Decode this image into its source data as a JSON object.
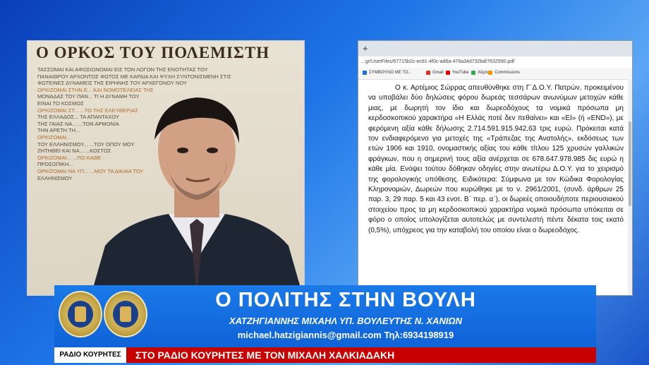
{
  "poster": {
    "title": "Ο ΟΡΚΟΣ ΤΟΥ ΠΟΛΕΜΙΣΤΗ",
    "lines": [
      "ΤΑΣΣΟΜΑΙ ΚΑΙ ΑΦΟΣΙΩΝΟΜΑΙ ΕΙΣ ΤΟΝ ΛΟΓΟΝ ΤΗΣ ΕΝΟΤΗΤΑΣ ΤΟΥ",
      "ΠΑΝΑΙΘΡΟΥ ΑΡΧΟΝΤΟΣ ΦΩΤΟΣ ΜΕ ΚΑΡΔΙΑ ΚΑΙ ΨΥΧΗ ΣΥΝΤΟΝΙΣΜΕΝΗ ΣΤΙΣ",
      "ΦΩΤΕΙΝΕΣ ΔΥΝΑΜΕΙΣ ΤΗΣ ΕΙΡΗΝΗΣ ΤΟΥ ΑΡΧΕΓΟΝΟΥ ΝΟΥ",
      "ΟΡΚΙΖΟΜΑΙ ΣΤΗΝ Ε... ΚΑΙ ΝΟΜΟΤΕΛΕΙΑΣ ΤΗΣ",
      "ΜΟΝΑΔΑΣ ΤΟΥ ΠΑΝ... ΤΙ Η ΔΥΝΑΜΗ ΤΟΥ",
      "ΕΙΝΑΙ ΤΟ ΚΟΣΜΟΣ",
      "ΟΡΚΙΖΟΜΑΙ ΣΤ... ...ΤΟ ΤΗΣ ΕΛΕΥΘΕΡΙΑΣ",
      "ΤΗΣ ΕΛΛΑΔΟΣ... ΤΑ ΑΠΑΝΤΑΧΟΥ",
      "ΤΗΣ ΓΑΙΑΣ ΝΑ... ...ΤΟΝ ΑΡΜΟΝΙΑ",
      "ΤΗΝ ΑΡΕΤΗ ΤΗ...",
      "ΟΡΚΙΖΟΜΑΙ...",
      "ΤΟΥ ΕΛΛΗΝΙΣΜΟΥ... ...ΤΟΥ ΟΠΟΥ ΜΟΥ",
      "ΖΗΤΗΘΕΙ ΚΑΙ ΝΑ... ...ΚΟΣΤΟΣ",
      "ΟΡΚΙΖΟΜΑΙ... ...ΠΟ ΚΑΘΕ",
      "ΠΡΟΣΩΠΙΚΗ...",
      "ΟΡΚΙΖΟΜΑΙ ΝΑ ΥΠ... ...ΜΟΥ ΤΑ ΔΙΚΑΙΑ ΤΟΥ",
      "ΕΛΛΗΝΙΣΜΟΥ"
    ]
  },
  "browser": {
    "new_tab_icon": "+",
    "url": "...gr/UserFiles/67715b2c-ec81-4f0c-ad6a-476a34d732bd/7632590.pdf",
    "bookmarks": [
      {
        "label": "ΣΥΜΒΟΥΛΙΟ ΜΕ ΤΟ...",
        "color": "#1f6fd1"
      },
      {
        "label": "Gmail",
        "color": "#d93025"
      },
      {
        "label": "YouTube",
        "color": "#e00000"
      },
      {
        "label": "Χάρτες",
        "color": "#34a853"
      },
      {
        "label": "Commissions",
        "color": "#f29900"
      }
    ],
    "document_text": "Ο κ. Αρτέμιος Σώρρας απευθύνθηκε στη Γ΄Δ.Ο.Υ. Πατρών, προκειμένου να υποβάλει δύο δηλώσεις φόρου δωρεάς τεσσάρων ανωνύμων μετοχών κάθε μιας, με δωρητή τον ίδιο και δωρεοδόχους τα νομικά πρόσωπα μη κερδοσκοπικού χαρακτήρα «Η Ελλάς ποτέ δεν πεθαίνει» και «ΕΙ» (ή «END»), με φερόμενη αξία κάθε δήλωσης 2.714.591.915.942,63 τρις ευρώ. Πρόκειται κατά τον ενδιαφερόμενο για μετοχές της «Τράπεζας της Ανατολής», εκδόσεως των ετών 1906 και 1910, ονομαστικής αξίας του κάθε τίτλου 125 χρυσών γαλλικών φράγκων, που η σημερινή τους αξία ανέρχεται σε 678.647.978.985 δις ευρώ η κάθε μία. Ενόψει τούτου δόθηκαν οδηγίες στην ανωτέρω Δ.Ο.Υ. για το χειρισμό της φορολογικής υπόθεσης. Ειδικότερα: Σύμφωνα με τον Κώδικα Φορολογίας Κληρονομιών, Δωρεών που κυρώθηκε με το ν. 2961/2001, (συνδ. άρθρων 25 παρ. 3, 29 παρ. 5 και 43 ενοτ. Β΄ περ. α΄), οι δωρεές οποιουδήποτε περιουσιακού στοιχείου προς τα μη κερδοσκοπικού χαρακτήρα νομικά πρόσωπα υπόκειται σε φόρο ο οποίος υπολογίζεται αυτοτελώς με συντελεστή πέντε δέκατα τοις εκατό (0,5%), υπόχρεος για την καταβολή του οποίου είναι ο δωρεοδόχος."
  },
  "banner": {
    "title": "Ο ΠΟΛΙΤΗΣ ΣΤΗΝ ΒΟΥΛΗ",
    "subtitle": "ΧΑΤΖΗΓΙΑΝΝΗΣ ΜΙΧΑΗΛ ΥΠ. ΒΟΥΛΕΥΤΗΣ Ν. ΧΑΝΙΩΝ",
    "contact": "michael.hatzigiannis@gmail.com Τηλ:6934198919"
  },
  "ticker": {
    "label": "ΡΑΔΙΟ ΚΟΥΡΗΤΕΣ",
    "text": "ΣΤΟ ΡΑΔΙΟ ΚΟΥΡΗΤΕΣ ΜΕ ΤΟΝ ΜΙΧΑΛΗ ΧΑΛΚΙΑΔΑΚΗ"
  }
}
